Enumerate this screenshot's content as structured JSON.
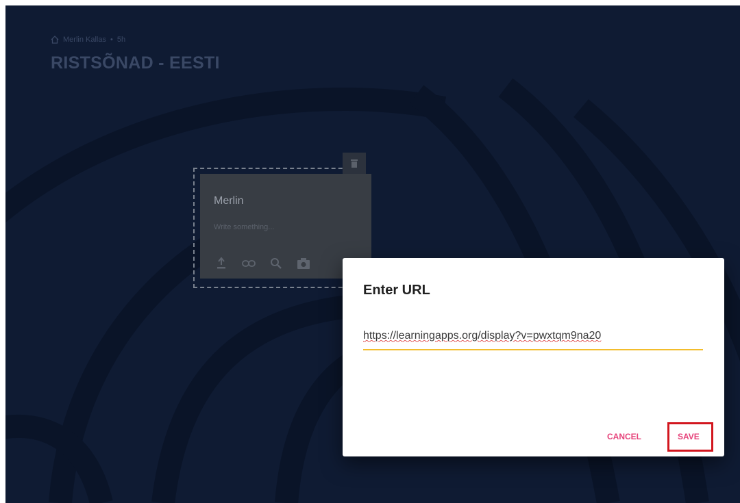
{
  "header": {
    "breadcrumb_user": "Merlin Kallas",
    "breadcrumb_separator": "•",
    "breadcrumb_extra": "5h",
    "title": "RISTSÕNAD - EESTI"
  },
  "post": {
    "author": "Merlin",
    "placeholder": "Write something...",
    "actions": [
      "upload-icon",
      "link-icon",
      "search-icon",
      "camera-icon"
    ]
  },
  "dialog": {
    "title": "Enter URL",
    "url_value": "https://learningapps.org/display?v=pwxtqm9na20",
    "cancel_label": "CANCEL",
    "save_label": "SAVE"
  },
  "colors": {
    "background": "#0f1b33",
    "accent": "#e6427a",
    "input_underline": "#f3bd2c",
    "highlight": "#d2161e"
  }
}
